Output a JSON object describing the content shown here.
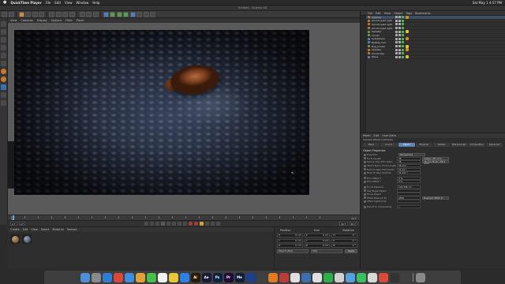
{
  "menubar": {
    "apple": "",
    "app_name": "QuickTime Player",
    "items": [
      "File",
      "Edit",
      "View",
      "Window",
      "Help"
    ],
    "clock": "Sat May 1  4:57 PM"
  },
  "window": {
    "title": "Untitled - Cinema 4D"
  },
  "viewport_menu": {
    "items": [
      "View",
      "Cameras",
      "Display",
      "Options",
      "Filter",
      "Panel"
    ]
  },
  "timeline": {
    "start": "0",
    "end": "90 F"
  },
  "playbar": {
    "current_frame": "0 F",
    "min_frame": "0 F",
    "max_frame": "90 F",
    "end_field": "90 F"
  },
  "material_manager": {
    "menu": [
      "Create",
      "Edit",
      "View",
      "Select",
      "Material",
      "Texture"
    ],
    "materials": [
      "Mat",
      "Mat.1"
    ]
  },
  "coordinates": {
    "headers": [
      "Position",
      "Size",
      "Rotation"
    ],
    "rows": [
      {
        "pos_axis": "X",
        "pos": "0 cm",
        "size_axis": "X",
        "size": "0 cm",
        "rot_axis": "H",
        "rot": "0 °"
      },
      {
        "pos_axis": "Y",
        "pos": "0 cm",
        "size_axis": "Y",
        "size": "0 cm",
        "rot_axis": "P",
        "rot": "0 °"
      },
      {
        "pos_axis": "Z",
        "pos": "0 cm",
        "size_axis": "Z",
        "size": "0 cm",
        "rot_axis": "B",
        "rot": "0 °"
      }
    ],
    "mode": "Object (Rel)",
    "size_mode": "Size",
    "apply": "Apply"
  },
  "object_manager": {
    "menu": [
      "File",
      "Edit",
      "View",
      "Object",
      "Tags",
      "Bookmarks"
    ],
    "objects": [
      {
        "name": "Camera",
        "icon": "orange",
        "tag": "o"
      },
      {
        "name": "Arnold quad light",
        "icon": "orange",
        "tag": ""
      },
      {
        "name": "Arnold quad light",
        "icon": "orange",
        "tag": ""
      },
      {
        "name": "Arnold quad light",
        "icon": "orange",
        "tag": ""
      },
      {
        "name": "Sweater",
        "icon": "green",
        "tag": "y"
      },
      {
        "name": "Cloner",
        "icon": "green",
        "tag": ""
      },
      {
        "name": "Subdivision",
        "icon": "blue",
        "tag": "o"
      },
      {
        "name": "Bubble_mm",
        "icon": "blue",
        "tag": ""
      },
      {
        "name": "Bug_model",
        "icon": "green",
        "tag": "y"
      },
      {
        "name": "Sweater",
        "icon": "orange",
        "tag": "o"
      },
      {
        "name": "Arnold Sky",
        "icon": "orange",
        "tag": ""
      },
      {
        "name": "Plane",
        "icon": "blue",
        "tag": "y"
      }
    ]
  },
  "attribute_manager": {
    "menu": [
      "Mode",
      "Edit",
      "User Data"
    ],
    "object_label": "Camera Object [Camera]",
    "tabs": [
      "Basic",
      "Coord.",
      "Object",
      "Physical",
      "Details",
      "Stereoscopic",
      "Composition",
      "Spherical"
    ],
    "active_tab": 2,
    "section": "Object Properties",
    "rows": [
      {
        "label": "Projection",
        "value": "Perspective",
        "type": "dd"
      },
      {
        "label": "Focal Length",
        "value": "36",
        "extra": "Classic (36 mm)"
      },
      {
        "label": "Sensor Size (Film Gate)",
        "value": "36",
        "extra": "35 mm Photo (36.0 mm)"
      },
      {
        "label": "35mm Equiv. Focal Length",
        "value": "36 mm"
      },
      {
        "label": "Field of View (Horizontal)",
        "value": "53.13 °"
      },
      {
        "label": "Field of View (Vertical)",
        "value": "31.417 °"
      },
      {
        "label": "",
        "value": ""
      },
      {
        "label": "Film Offset X",
        "value": "0 %"
      },
      {
        "label": "Film Offset Y",
        "value": "0 %"
      },
      {
        "label": "",
        "value": ""
      },
      {
        "label": "Focus Distance",
        "value": "119.356 cm"
      },
      {
        "label": "Use Target Object",
        "value": ""
      },
      {
        "label": "Focus Object",
        "value": ""
      },
      {
        "label": "White Balance (K)",
        "value": "6500",
        "extra": "Daylight (6500 K)"
      },
      {
        "label": "Affect Lights Only",
        "value": ""
      },
      {
        "label": "",
        "value": ""
      },
      {
        "label": "Export to Compositing",
        "value": "✓"
      }
    ]
  },
  "dock": {
    "apps": [
      {
        "name": "finder",
        "label": "",
        "color": "#4d8fd6"
      },
      {
        "name": "launchpad",
        "label": "",
        "color": "#8a8a8a"
      },
      {
        "name": "safari",
        "label": "",
        "color": "#2d7fd3"
      },
      {
        "name": "chrome",
        "label": "",
        "color": "#d9483b"
      },
      {
        "name": "mail",
        "label": "",
        "color": "#3e8ee0"
      },
      {
        "name": "photos",
        "label": "",
        "color": "#e0a23a"
      },
      {
        "name": "messages",
        "label": "",
        "color": "#45c04a"
      },
      {
        "name": "calendar",
        "label": "",
        "color": "#f2f2f2"
      },
      {
        "name": "notes",
        "label": "",
        "color": "#e8c73a"
      },
      {
        "name": "appstore",
        "label": "",
        "color": "#2f7fe6"
      },
      {
        "name": "illustrator",
        "label": "Ai",
        "color": "#2a1a08"
      },
      {
        "name": "aftereffects",
        "label": "Ae",
        "color": "#1a1a3a"
      },
      {
        "name": "photoshop",
        "label": "Ps",
        "color": "#0b2340"
      },
      {
        "name": "premiere",
        "label": "Pr",
        "color": "#1e0a35"
      },
      {
        "name": "mediaencoder",
        "label": "Me",
        "color": "#0f1e38"
      },
      {
        "name": "cinema4d",
        "label": "",
        "color": "#1f3e8c"
      },
      {
        "name": "quicktime",
        "label": "",
        "color": "#404040"
      },
      {
        "name": "vlc",
        "label": "",
        "color": "#e07b22"
      },
      {
        "name": "app1",
        "label": "",
        "color": "#bb3b3b"
      },
      {
        "name": "app2",
        "label": "",
        "color": "#e0e0e0"
      },
      {
        "name": "app3",
        "label": "",
        "color": "#3b6fb0"
      },
      {
        "name": "app4",
        "label": "",
        "color": "#e0e0e0"
      },
      {
        "name": "app5",
        "label": "",
        "color": "#2faf4a"
      },
      {
        "name": "app6",
        "label": "",
        "color": "#d0d0d0"
      },
      {
        "name": "app7",
        "label": "",
        "color": "#55a0e0"
      },
      {
        "name": "app8",
        "label": "",
        "color": "#3ac060"
      },
      {
        "name": "app9",
        "label": "",
        "color": "#d8d8d8"
      },
      {
        "name": "app10",
        "label": "",
        "color": "#d84a3a"
      },
      {
        "name": "app11",
        "label": "",
        "color": "#333333"
      },
      {
        "name": "app12",
        "label": "",
        "color": "#404040"
      }
    ],
    "trash": {
      "name": "trash",
      "color": "#8a8a8a"
    }
  },
  "colors": {
    "accent": "#5d86b5",
    "toolbar_accent": "#d08a3a",
    "timeline_head": "#6ab0e0"
  }
}
